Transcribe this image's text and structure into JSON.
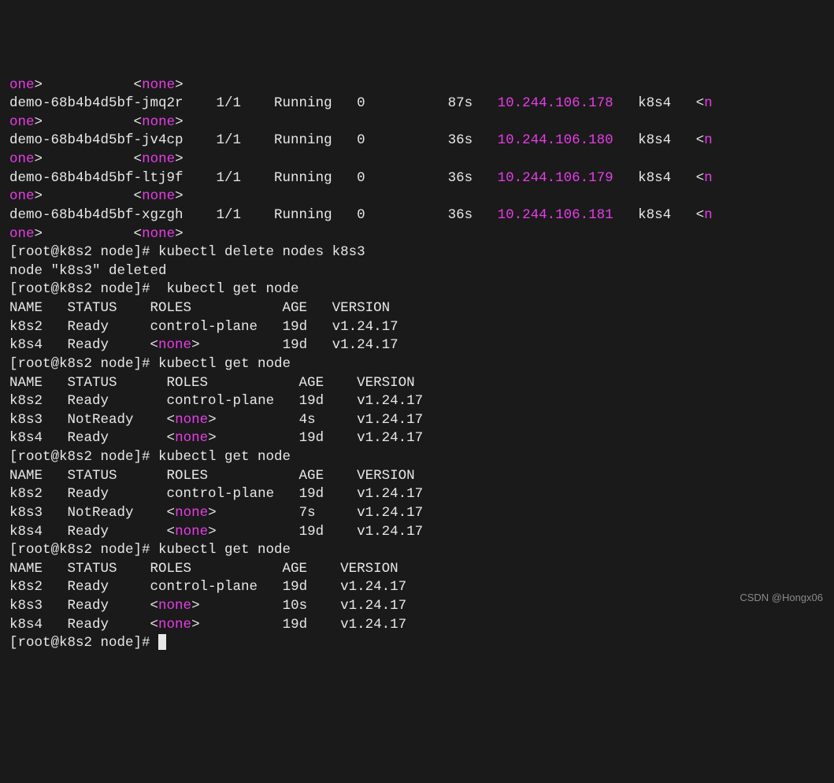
{
  "prompt_user": "root",
  "prompt_host": "k8s2",
  "prompt_dir": "node",
  "none": "none",
  "angle_open": "<",
  "angle_close": ">",
  "one": "one",
  "n_suffix": "n",
  "pods": [
    {
      "name": "demo-68b4b4d5bf-jmq2r",
      "ready": "1/1",
      "status": "Running",
      "restarts": "0",
      "age": "87s",
      "ip": "10.244.106.178",
      "node": "k8s4"
    },
    {
      "name": "demo-68b4b4d5bf-jv4cp",
      "ready": "1/1",
      "status": "Running",
      "restarts": "0",
      "age": "36s",
      "ip": "10.244.106.180",
      "node": "k8s4"
    },
    {
      "name": "demo-68b4b4d5bf-ltj9f",
      "ready": "1/1",
      "status": "Running",
      "restarts": "0",
      "age": "36s",
      "ip": "10.244.106.179",
      "node": "k8s4"
    },
    {
      "name": "demo-68b4b4d5bf-xgzgh",
      "ready": "1/1",
      "status": "Running",
      "restarts": "0",
      "age": "36s",
      "ip": "10.244.106.181",
      "node": "k8s4"
    }
  ],
  "cmd_delete": "kubectl delete nodes k8s3",
  "delete_response": "node \"k8s3\" deleted",
  "cmd_get1": " kubectl get node",
  "cmd_get2": "kubectl get node",
  "header": {
    "name": "NAME",
    "status": "STATUS",
    "roles": "ROLES",
    "age": "AGE",
    "version": "VERSION"
  },
  "nodes1": [
    {
      "name": "k8s2",
      "status": "Ready",
      "roles": "control-plane",
      "age": "19d",
      "version": "v1.24.17",
      "roles_none": false
    },
    {
      "name": "k8s4",
      "status": "Ready",
      "roles": "",
      "age": "19d",
      "version": "v1.24.17",
      "roles_none": true
    }
  ],
  "nodes2": [
    {
      "name": "k8s2",
      "status": "Ready",
      "roles": "control-plane",
      "age": "19d",
      "version": "v1.24.17",
      "roles_none": false
    },
    {
      "name": "k8s3",
      "status": "NotReady",
      "roles": "",
      "age": "4s",
      "version": "v1.24.17",
      "roles_none": true
    },
    {
      "name": "k8s4",
      "status": "Ready",
      "roles": "",
      "age": "19d",
      "version": "v1.24.17",
      "roles_none": true
    }
  ],
  "nodes3": [
    {
      "name": "k8s2",
      "status": "Ready",
      "roles": "control-plane",
      "age": "19d",
      "version": "v1.24.17",
      "roles_none": false
    },
    {
      "name": "k8s3",
      "status": "NotReady",
      "roles": "",
      "age": "7s",
      "version": "v1.24.17",
      "roles_none": true
    },
    {
      "name": "k8s4",
      "status": "Ready",
      "roles": "",
      "age": "19d",
      "version": "v1.24.17",
      "roles_none": true
    }
  ],
  "nodes4": [
    {
      "name": "k8s2",
      "status": "Ready",
      "roles": "control-plane",
      "age": "19d",
      "version": "v1.24.17",
      "roles_none": false
    },
    {
      "name": "k8s3",
      "status": "Ready",
      "roles": "",
      "age": "10s",
      "version": "v1.24.17",
      "roles_none": true
    },
    {
      "name": "k8s4",
      "status": "Ready",
      "roles": "",
      "age": "19d",
      "version": "v1.24.17",
      "roles_none": true
    }
  ],
  "watermark": "CSDN @Hongx06"
}
